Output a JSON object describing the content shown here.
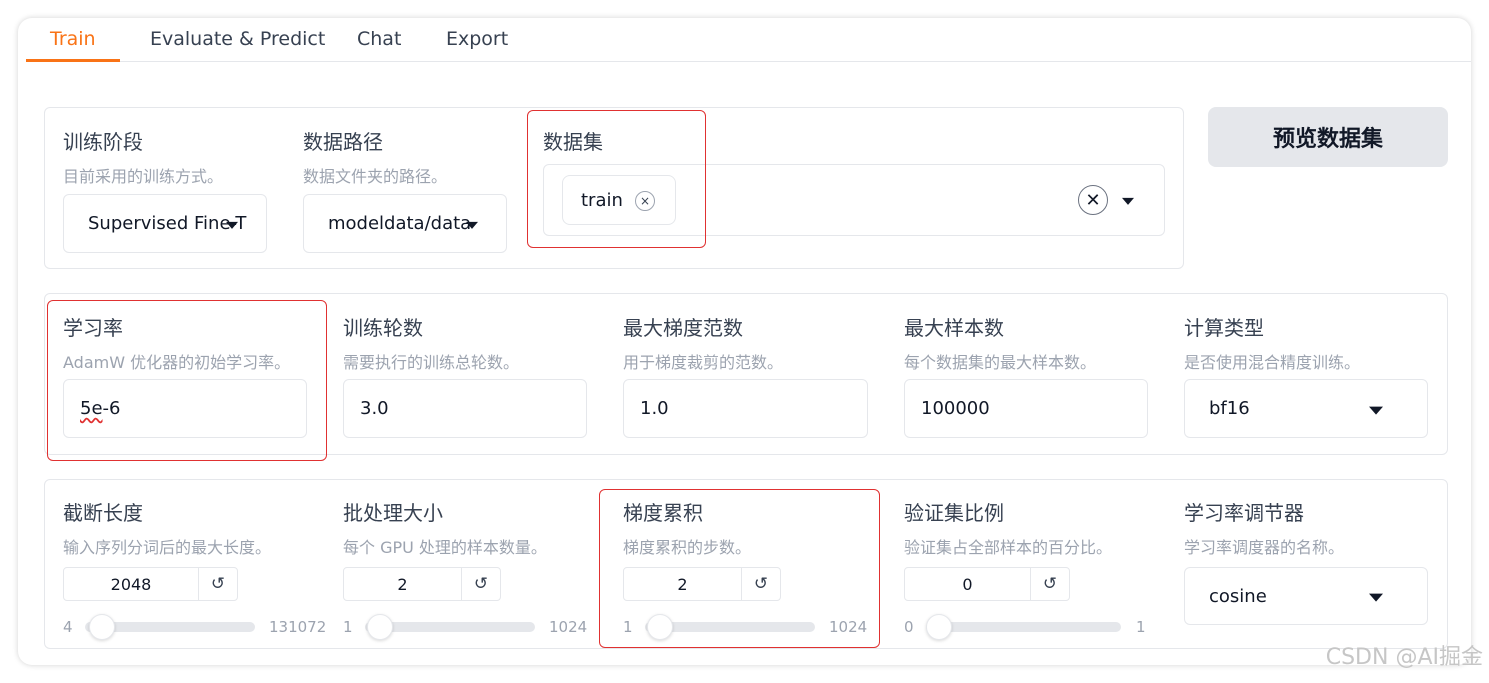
{
  "tabs": [
    "Train",
    "Evaluate & Predict",
    "Chat",
    "Export"
  ],
  "active_tab": "Train",
  "accent_color": "#f97316",
  "highlight_color": "#e03131",
  "row1": {
    "stage": {
      "label": "训练阶段",
      "desc": "目前采用的训练方式。",
      "value": "Supervised Fine-T"
    },
    "dataset_dir": {
      "label": "数据路径",
      "desc": "数据文件夹的路径。",
      "value": "modeldata/data"
    },
    "dataset": {
      "label": "数据集",
      "chip": "train"
    },
    "preview_button": "预览数据集"
  },
  "row2": {
    "learning_rate": {
      "label": "学习率",
      "desc": "AdamW 优化器的初始学习率。",
      "value_a": "5e",
      "value_b": "-6"
    },
    "epochs": {
      "label": "训练轮数",
      "desc": "需要执行的训练总轮数。",
      "value": "3.0"
    },
    "max_grad_norm": {
      "label": "最大梯度范数",
      "desc": "用于梯度裁剪的范数。",
      "value": "1.0"
    },
    "max_samples": {
      "label": "最大样本数",
      "desc": "每个数据集的最大样本数。",
      "value": "100000"
    },
    "compute_type": {
      "label": "计算类型",
      "desc": "是否使用混合精度训练。",
      "value": "bf16"
    }
  },
  "row3": {
    "cutoff_len": {
      "label": "截断长度",
      "desc": "输入序列分词后的最大长度。",
      "value": "2048",
      "min": "4",
      "max": "131072",
      "fraction": 0.015
    },
    "batch_size": {
      "label": "批处理大小",
      "desc": "每个 GPU 处理的样本数量。",
      "value": "2",
      "min": "1",
      "max": "1024",
      "fraction": 0.001
    },
    "grad_accum": {
      "label": "梯度累积",
      "desc": "梯度累积的步数。",
      "value": "2",
      "min": "1",
      "max": "1024",
      "fraction": 0.001
    },
    "val_size": {
      "label": "验证集比例",
      "desc": "验证集占全部样本的百分比。",
      "value": "0",
      "min": "0",
      "max": "1",
      "fraction": 0.0
    },
    "lr_scheduler": {
      "label": "学习率调节器",
      "desc": "学习率调度器的名称。",
      "value": "cosine"
    }
  },
  "icons": {
    "reset": "↺",
    "remove": "×",
    "clear": "✕"
  },
  "watermark": "CSDN @AI掘金"
}
